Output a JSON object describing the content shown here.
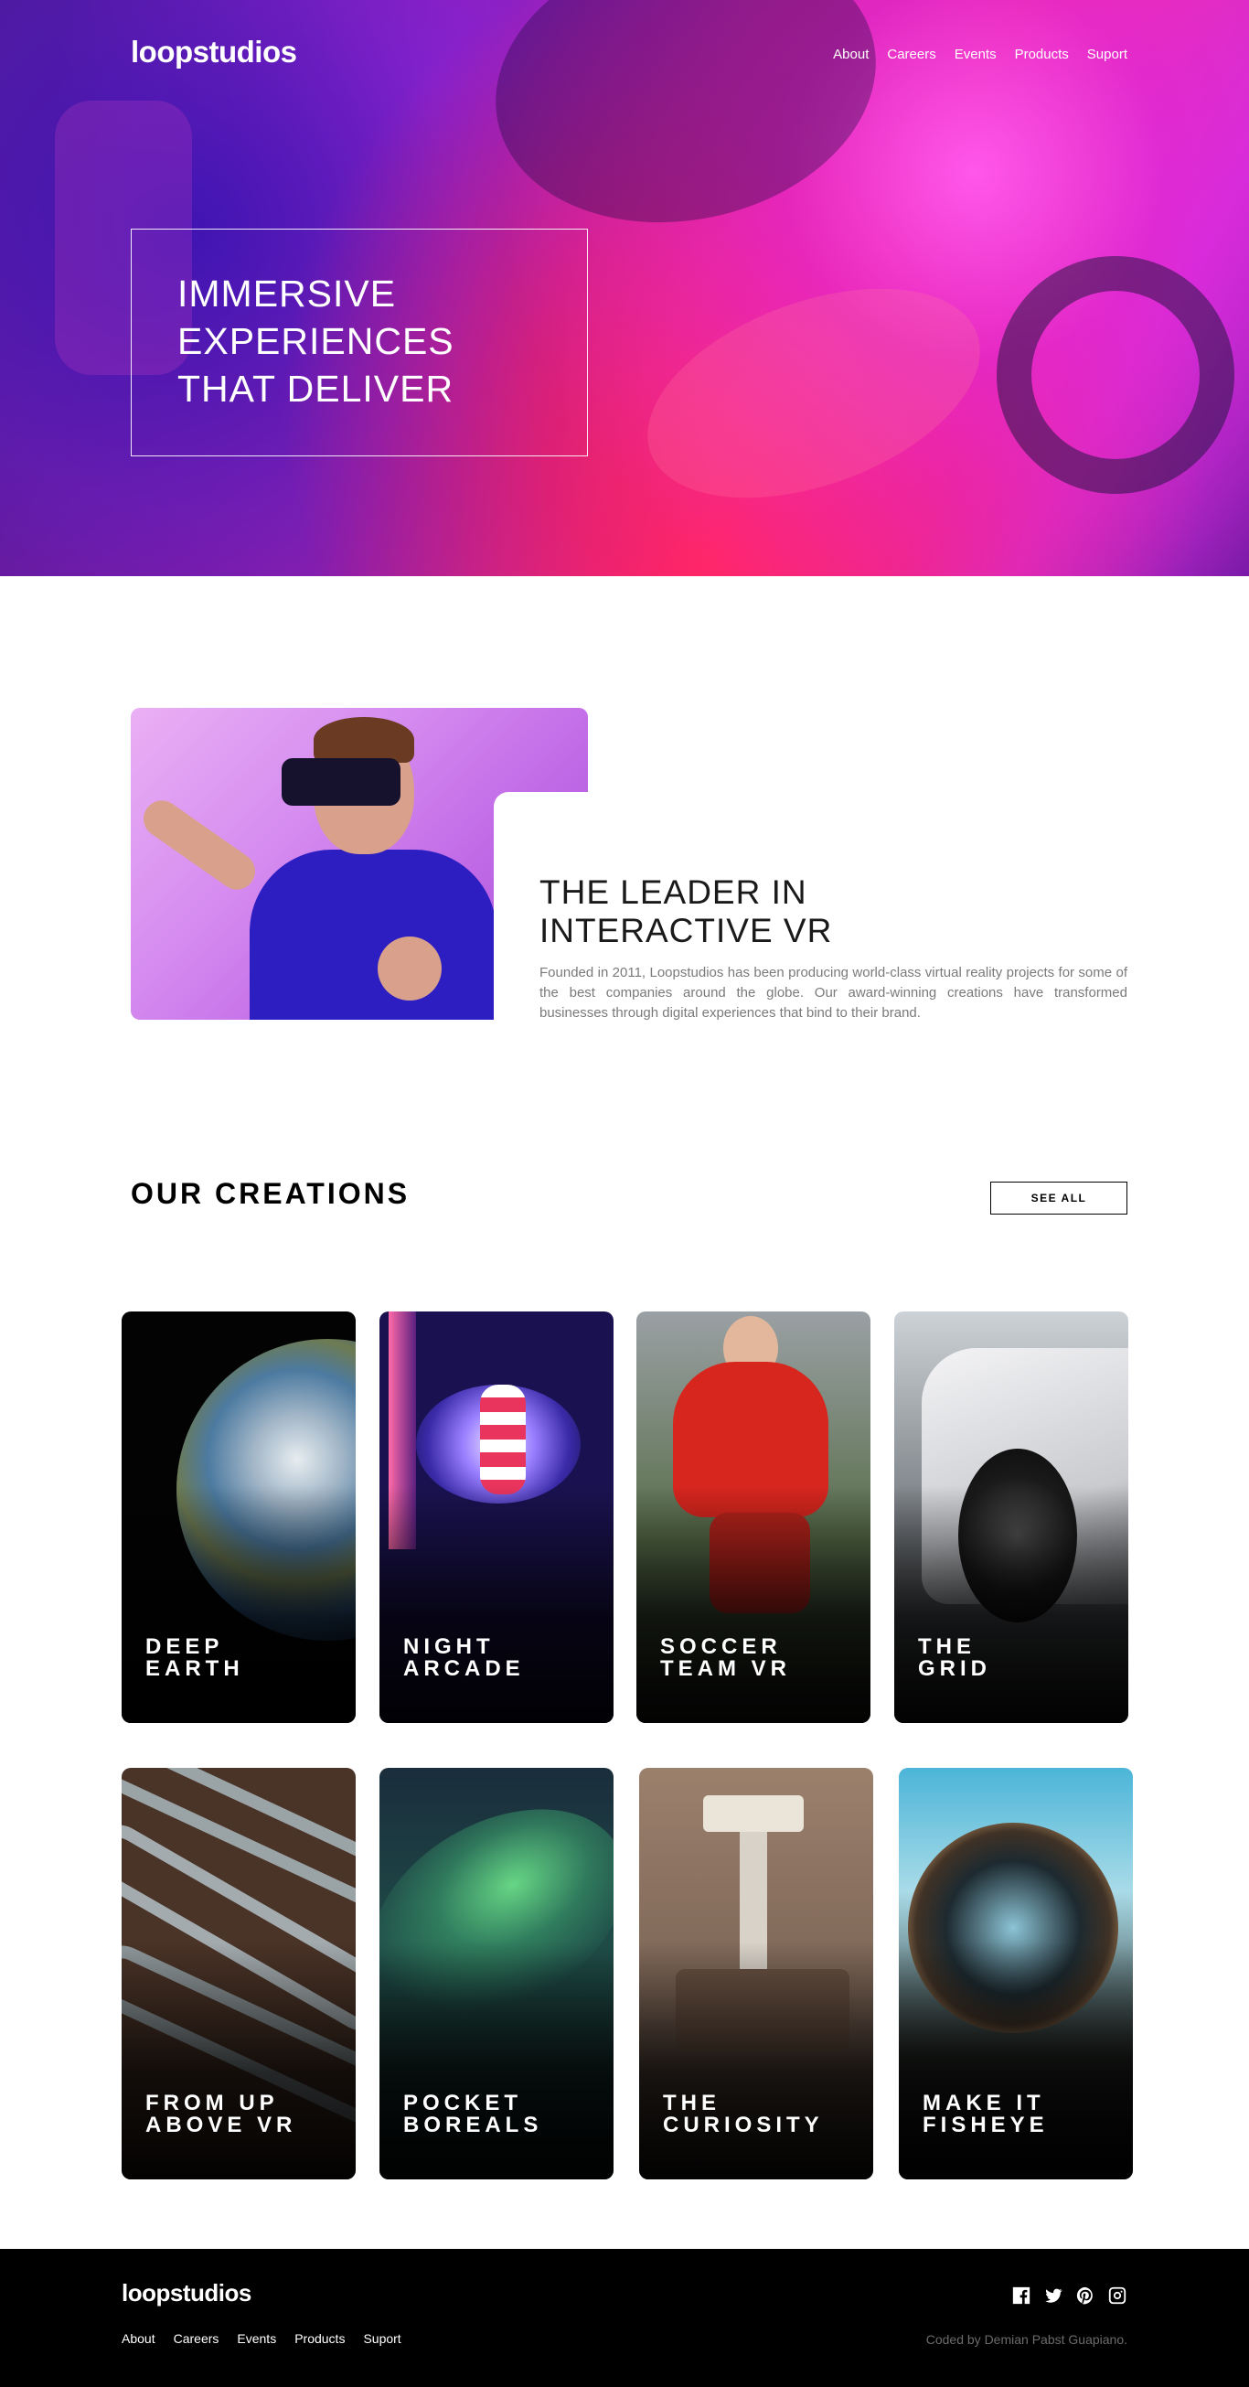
{
  "brand": {
    "logo": "loopstudios"
  },
  "nav": {
    "items": [
      "About",
      "Careers",
      "Events",
      "Products",
      "Suport"
    ]
  },
  "hero": {
    "headline_lines": [
      "IMMERSIVE",
      "EXPERIENCES",
      "THAT DELIVER"
    ]
  },
  "intro": {
    "title_lines": [
      "THE LEADER IN",
      "INTERACTIVE VR"
    ],
    "text": "Founded in 2011, Loopstudios has been producing world-class virtual reality projects for some of the best companies around the globe. Our award-winning creations have transformed businesses through digital experiences that bind to their brand."
  },
  "creations": {
    "title": "OUR CREATIONS",
    "see_all": "SEE ALL",
    "cards": [
      {
        "lines": [
          "DEEP",
          "EARTH"
        ]
      },
      {
        "lines": [
          "NIGHT",
          "ARCADE"
        ]
      },
      {
        "lines": [
          "SOCCER",
          "TEAM VR"
        ]
      },
      {
        "lines": [
          "THE",
          "GRID"
        ]
      },
      {
        "lines": [
          "FROM UP",
          "ABOVE VR"
        ]
      },
      {
        "lines": [
          "POCKET",
          "BOREALS"
        ]
      },
      {
        "lines": [
          "THE",
          "CURIOSITY"
        ]
      },
      {
        "lines": [
          "MAKE IT",
          "FISHEYE"
        ]
      }
    ]
  },
  "footer": {
    "logo": "loopstudios",
    "nav": [
      "About",
      "Careers",
      "Events",
      "Products",
      "Suport"
    ],
    "social_icons": [
      "facebook-icon",
      "twitter-icon",
      "pinterest-icon",
      "instagram-icon"
    ],
    "credit": "Coded by Demian Pabst Guapiano."
  },
  "colors": {
    "footer_bg": "#000000",
    "text_muted": "#7a7a7a",
    "accent_white": "#ffffff"
  }
}
